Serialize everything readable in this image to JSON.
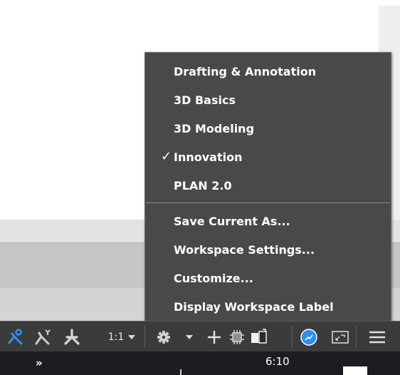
{
  "workspace_menu": {
    "items": [
      {
        "label": "Drafting & Annotation",
        "checked": false
      },
      {
        "label": "3D Basics",
        "checked": false
      },
      {
        "label": "3D Modeling",
        "checked": false
      },
      {
        "label": "Innovation",
        "checked": true
      },
      {
        "label": "PLAN 2.0",
        "checked": false
      }
    ],
    "check_mark": "✓",
    "actions": [
      {
        "label": "Save Current As..."
      },
      {
        "label": "Workspace Settings..."
      },
      {
        "label": "Customize..."
      },
      {
        "label": "Display Workspace Label"
      }
    ]
  },
  "status_bar": {
    "annotation_scale": "1:1",
    "icons": [
      "annotation-visibility-icon",
      "auto-scale-icon",
      "annotation-monitor-icon",
      "workspace-gear-icon",
      "plus-icon",
      "hardware-accel-icon",
      "isolate-objects-icon",
      "clean-screen-icon",
      "fullscreen-icon",
      "customization-menu-icon"
    ],
    "accent_color": "#2a8ff7"
  },
  "taskbar": {
    "overflow": "»",
    "clock": "6:10"
  }
}
